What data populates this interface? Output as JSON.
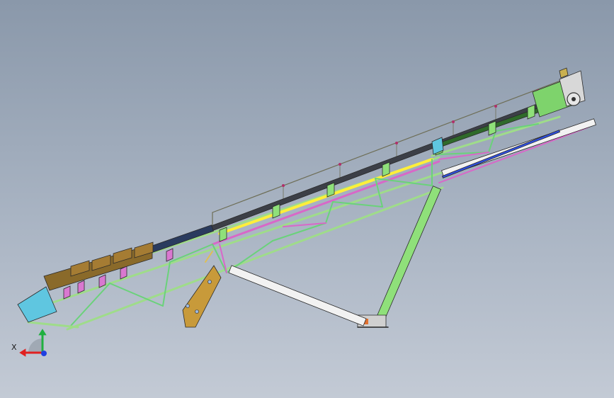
{
  "viewport": {
    "background_top": "#8a98aa",
    "background_bottom": "#c3cad5"
  },
  "model": {
    "name": "",
    "parts": [
      "conveyor-belt",
      "truss-frame",
      "hopper",
      "drive-unit",
      "head-pulley",
      "support-leg",
      "tension-rod",
      "adjustable-strut",
      "guard-rail",
      "idler-set"
    ],
    "colors": {
      "belt": "#3c3f47",
      "belt_tail": "#2a3b5e",
      "hopper": "#5fc6e0",
      "drive": "#7ed36c",
      "truss_green": "#9fdc8a",
      "truss_magenta": "#d868c8",
      "truss_yellow": "#ffef3a",
      "support_leg": "#8fe07a",
      "tension_rod": "#f2f2f2",
      "strut": "#c89a3a",
      "idler": "#d978d0",
      "rail": "#6d6d55"
    }
  },
  "triad": {
    "x_label": "X",
    "y_label": "",
    "x_color": "#e02020",
    "y_color": "#20b040",
    "z_color": "#2040e0"
  }
}
